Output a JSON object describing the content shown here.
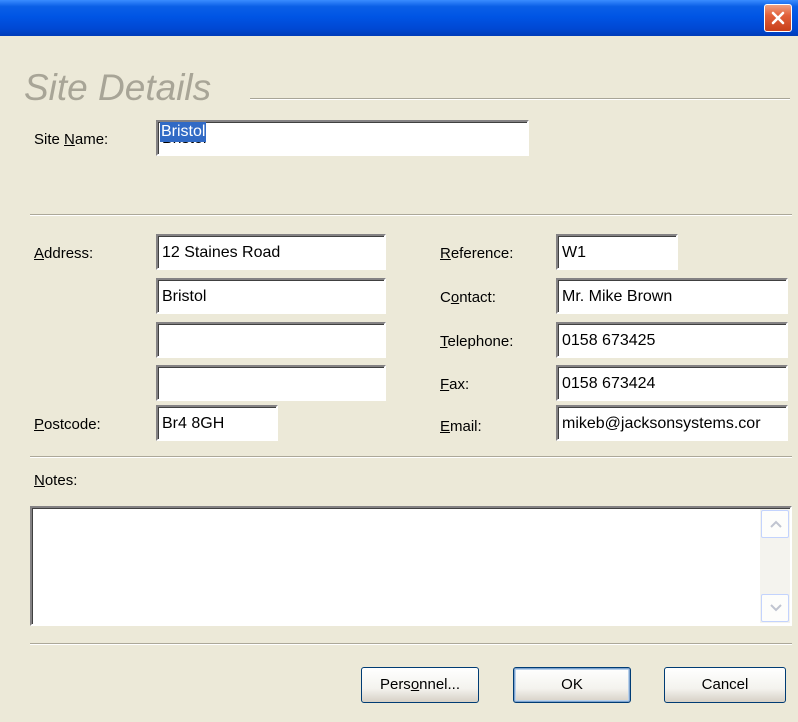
{
  "window": {
    "heading": "Site Details"
  },
  "site": {
    "name_label_pre": "Site ",
    "name_label_key": "N",
    "name_label_post": "ame:",
    "name_value": "Bristol"
  },
  "address": {
    "label_key": "A",
    "label_post": "ddress:",
    "line1": "12 Staines Road",
    "line2": "Bristol",
    "line3": "",
    "line4": ""
  },
  "postcode": {
    "label_key": "P",
    "label_post": "ostcode:",
    "value": "Br4 8GH"
  },
  "reference": {
    "label_key": "R",
    "label_post": "eference:",
    "value": "W1"
  },
  "contact": {
    "label_pre": "C",
    "label_key": "o",
    "label_post": "ntact:",
    "value": "Mr. Mike Brown"
  },
  "telephone": {
    "label_key": "T",
    "label_post": "elephone:",
    "value": "0158 673425"
  },
  "fax": {
    "label_key": "F",
    "label_post": "ax:",
    "value": "0158 673424"
  },
  "email": {
    "label_key": "E",
    "label_post": "mail:",
    "value": "mikeb@jacksonsystems.cor"
  },
  "notes": {
    "label_key": "N",
    "label_post": "otes:",
    "value": ""
  },
  "buttons": {
    "personnel_pre": "Pers",
    "personnel_key": "o",
    "personnel_post": "nnel...",
    "ok": "OK",
    "cancel": "Cancel"
  },
  "icons": {
    "close": "close-icon",
    "scroll_up": "scroll-up-arrow-icon",
    "scroll_down": "scroll-down-arrow-icon"
  },
  "colors": {
    "titlebar": "#0055E5",
    "close_button": "#E2603A",
    "dialog_background": "#ECE9D8",
    "heading_text": "#A8A597",
    "selection": "#316AC5",
    "button_border": "#003C74"
  }
}
